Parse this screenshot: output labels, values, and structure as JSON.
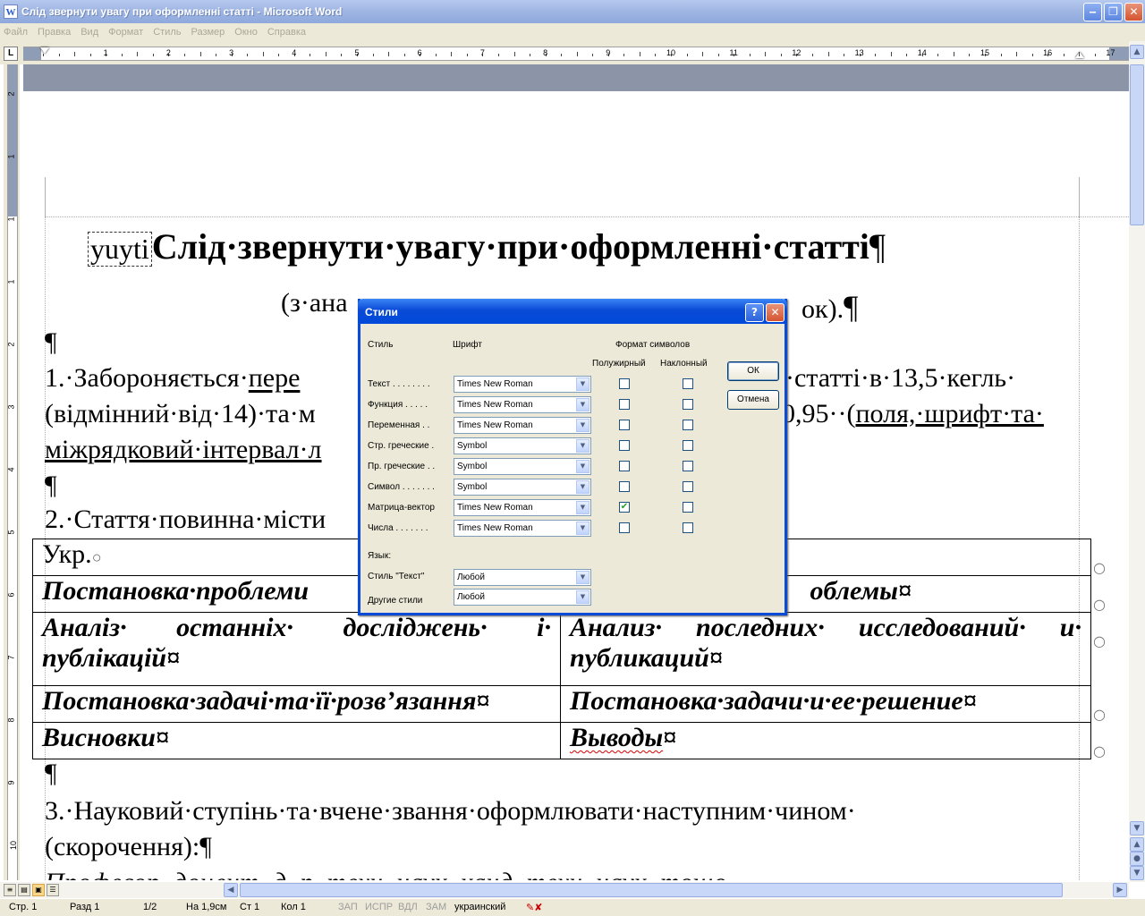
{
  "window": {
    "title": "Слід звернути увагу при оформленні статті - Microsoft Word",
    "min": "‒",
    "max": "❐",
    "close": "✕",
    "app_glyph": "W"
  },
  "menu": [
    "Файл",
    "Правка",
    "Вид",
    "Формат",
    "Стиль",
    "Размер",
    "Окно",
    "Справка"
  ],
  "ruler": {
    "tab_selector": "L",
    "numbers": [
      "1",
      "2",
      "3",
      "4",
      "5",
      "6",
      "7",
      "8",
      "9",
      "10",
      "11",
      "12",
      "13",
      "14",
      "15",
      "16",
      "17"
    ],
    "vnumbers": [
      "2",
      "1",
      "1",
      "1",
      "2",
      "3",
      "4",
      "5",
      "6",
      "7",
      "8",
      "9",
      "10"
    ]
  },
  "document": {
    "field_box": "yuyti",
    "heading": "Слід·звернути·увагу·при·оформленні·статті",
    "pilcrow": "¶",
    "subtitle_left": "(з·ана",
    "subtitle_right": "ок).",
    "para1_line1_left": "1.·Забороняється·",
    "para1_line1_under": "пере",
    "para1_line1_right": "·статті·в·13,5·кегль·",
    "para1_line2_left": "(відмінний·від·14)·та·м",
    "para1_line2_right": "0,95··(",
    "para1_line2_under": "поля,·шрифт·та·",
    "para1_line3": "міжрядковий·інтервал·л",
    "para2": "2.·Стаття·повинна·місти",
    "para3_line1": "3.·Науковий·ступінь·та·вчене·звання·оформлювати·наступним·чином·",
    "para3_line2": "(скорочення):",
    "para4": "Професор,·доцент,·д.·р.·техн.·наук,·канд.·техн.·наук,·тощо.",
    "cell_mark": "¤",
    "table": [
      [
        "Укр.",
        ""
      ],
      [
        "Постановка·проблеми",
        "облемы"
      ],
      [
        "Аналіз· останніх· досліджень· і· публікацій",
        "Анализ· последних· исследований· и· публикаций"
      ],
      [
        "Постановка·задачі·та·її·розв’язання",
        "Постановка·задачи·и·ее·решение"
      ],
      [
        "Висновки",
        "Выводы"
      ]
    ]
  },
  "dialog": {
    "title": "Стили",
    "help": "?",
    "close": "✕",
    "col_style": "Стиль",
    "col_font": "Шрифт",
    "col_format": "Формат символов",
    "col_bold": "Полужирный",
    "col_italic": "Наклонный",
    "ok": "ОК",
    "cancel": "Отмена",
    "rows": [
      {
        "label": "Текст . . . . . . . .",
        "font": "Times New Roman",
        "bold": false,
        "italic": false
      },
      {
        "label": "Функция  . . . . .",
        "font": "Times New Roman",
        "bold": false,
        "italic": false
      },
      {
        "label": "Переменная . .",
        "font": "Times New Roman",
        "bold": false,
        "italic": false
      },
      {
        "label": "Стр. греческие .",
        "font": "Symbol",
        "bold": false,
        "italic": false
      },
      {
        "label": "Пр. греческие . .",
        "font": "Symbol",
        "bold": false,
        "italic": false
      },
      {
        "label": "Символ . . . . . . .",
        "font": "Symbol",
        "bold": false,
        "italic": false
      },
      {
        "label": "Матрица-вектор",
        "font": "Times New Roman",
        "bold": true,
        "italic": false
      },
      {
        "label": "Числа . . . . . . .",
        "font": "Times New Roman",
        "bold": false,
        "italic": false
      }
    ],
    "lang_label": "Язык:",
    "lang_text_label": "Стиль \"Текст\"",
    "lang_text_value": "Любой",
    "lang_other_label": "Другие стили",
    "lang_other_value": "Любой"
  },
  "status": {
    "page": "Стр. 1",
    "section": "Разд 1",
    "pages": "1/2",
    "at": "На 1,9см",
    "line": "Ст 1",
    "col": "Кол 1",
    "rec": "ЗАП",
    "trk": "ИСПР",
    "ext": "ВДЛ",
    "ovr": "ЗАМ",
    "lang": "украинский",
    "spell": "✎✘"
  }
}
